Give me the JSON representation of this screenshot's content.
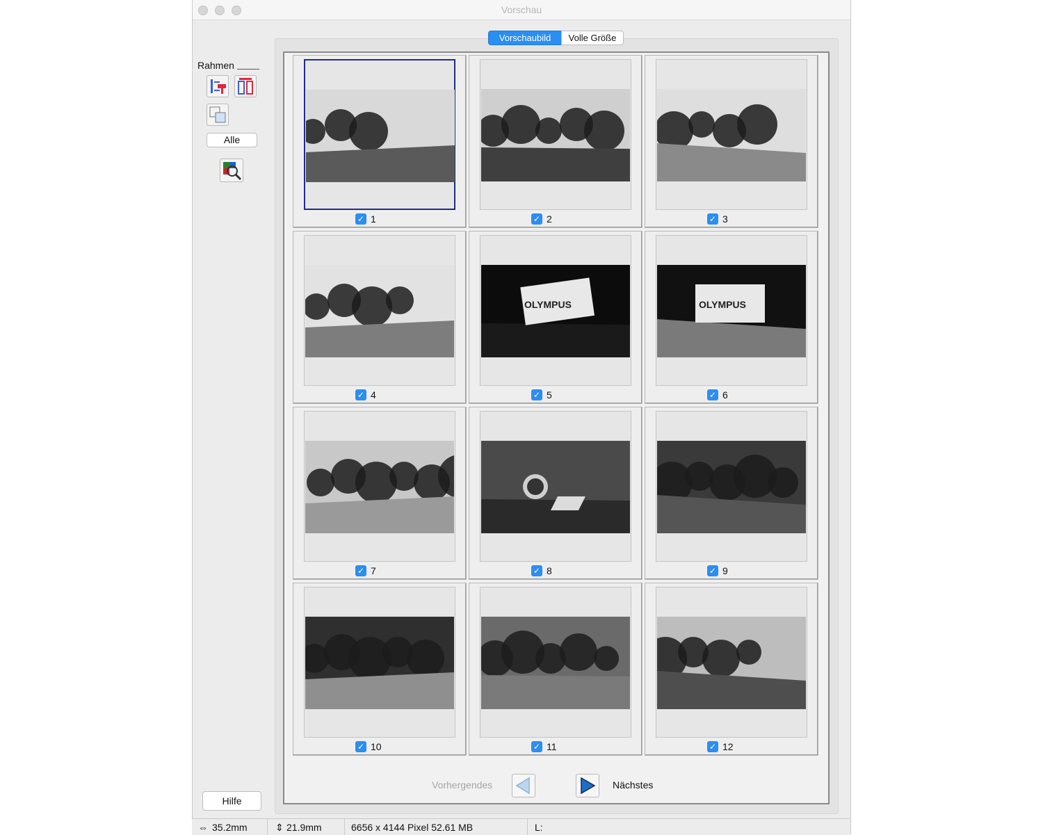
{
  "window": {
    "title": "Vorschau"
  },
  "sidebar": {
    "frame_label": "Rahmen",
    "all_button": "Alle",
    "help_button": "Hilfe"
  },
  "tabs": {
    "preview": "Vorschaubild",
    "full": "Volle Größe",
    "active": "preview"
  },
  "thumbnails": [
    {
      "label": "1",
      "checked": true,
      "selected": true
    },
    {
      "label": "2",
      "checked": true
    },
    {
      "label": "3",
      "checked": true
    },
    {
      "label": "4",
      "checked": true
    },
    {
      "label": "5",
      "checked": true
    },
    {
      "label": "6",
      "checked": true
    },
    {
      "label": "7",
      "checked": true
    },
    {
      "label": "8",
      "checked": true
    },
    {
      "label": "9",
      "checked": true
    },
    {
      "label": "10",
      "checked": true
    },
    {
      "label": "11",
      "checked": true
    },
    {
      "label": "12",
      "checked": true
    }
  ],
  "nav": {
    "previous": "Vorhergendes",
    "next": "Nächstes"
  },
  "status": {
    "width": "35.2mm",
    "height": "21.9mm",
    "size": "6656 x 4144 Pixel 52.61 MB",
    "l": "L:"
  },
  "colors": {
    "accent": "#2c8ef0",
    "selection": "#1f2b8c"
  },
  "icons": [
    "width-arrow-icon",
    "height-arrow-icon",
    "auto-locate-icon",
    "split-frame-icon",
    "crop-icon",
    "color-zoom-icon",
    "prev-arrow-icon",
    "next-arrow-icon",
    "checkbox-checked-icon"
  ]
}
